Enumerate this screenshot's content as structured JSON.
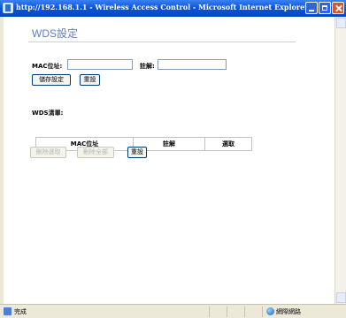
{
  "window": {
    "title": "http://192.168.1.1 - Wireless Access Control - Microsoft Internet Explorer"
  },
  "page": {
    "title": "WDS設定",
    "mac_label": "MAC位址:",
    "mac_value": "",
    "comment_label": "註解:",
    "comment_value": "",
    "save_button": "儲存設定",
    "reset_button": "重設",
    "list_title": "WDS清單:",
    "table_headers": [
      "MAC位址",
      "註解",
      "選取"
    ],
    "delete_selected_button": "刪除選取",
    "delete_all_button": "刪除全部",
    "reset_button_2": "重設"
  },
  "statusbar": {
    "status": "完成",
    "zone": "網際網路"
  },
  "colors": {
    "titlebar": "#0a52d8",
    "page_title": "#5f7fbf",
    "close_button": "#d9532f"
  },
  "icons": [
    "ie-icon",
    "minimize-icon",
    "maximize-icon",
    "close-icon",
    "page-done-icon",
    "internet-zone-icon"
  ]
}
